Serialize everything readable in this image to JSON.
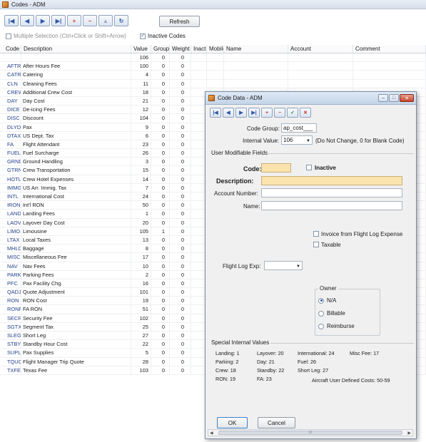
{
  "window": {
    "title": "Codes - ADM"
  },
  "toolbar": {
    "buttons": [
      {
        "icon": "first-record-icon",
        "glyph": "|◀"
      },
      {
        "icon": "previous-record-icon",
        "glyph": "◀"
      },
      {
        "icon": "next-record-icon",
        "glyph": "▶"
      },
      {
        "icon": "last-record-icon",
        "glyph": "▶|"
      },
      {
        "icon": "add-record-icon",
        "glyph": "+"
      },
      {
        "icon": "delete-record-icon",
        "glyph": "−"
      },
      {
        "icon": "up-icon",
        "glyph": "▲"
      },
      {
        "icon": "refresh-icon",
        "glyph": "↻"
      }
    ],
    "refresh_label": "Refresh"
  },
  "options": {
    "multi_select_label": "Multiple Selection (Ctrl+Click or Shift+Arrow)",
    "multi_select_checked": false,
    "inactive_label": "Inactive Codes",
    "inactive_checked": true
  },
  "grid": {
    "headers": [
      "Code",
      "Description",
      "Value",
      "Group",
      "Weight",
      "Inactive",
      "Mobile",
      "Name",
      "Account",
      "Comment"
    ],
    "rows": [
      {
        "code": "",
        "desc": "",
        "value": "106",
        "group": "0",
        "weight": "0"
      },
      {
        "code": "AFTR",
        "desc": "After Hours Fee",
        "value": "100",
        "group": "0",
        "weight": "0"
      },
      {
        "code": "CATR",
        "desc": "Catering",
        "value": "4",
        "group": "0",
        "weight": "0"
      },
      {
        "code": "CLN",
        "desc": "Cleaning Fees",
        "value": "11",
        "group": "0",
        "weight": "0"
      },
      {
        "code": "CREW",
        "desc": "Additional Crew Cost",
        "value": "18",
        "group": "0",
        "weight": "0"
      },
      {
        "code": "DAY",
        "desc": "Day Cost",
        "value": "21",
        "group": "0",
        "weight": "0"
      },
      {
        "code": "DICE",
        "desc": "De-icing Fees",
        "value": "12",
        "group": "0",
        "weight": "0"
      },
      {
        "code": "DISC",
        "desc": "Discount",
        "value": "104",
        "group": "0",
        "weight": "0"
      },
      {
        "code": "DLYD",
        "desc": "Pax",
        "value": "9",
        "group": "0",
        "weight": "0"
      },
      {
        "code": "DTAX",
        "desc": "US Dept. Tax",
        "value": "6",
        "group": "0",
        "weight": "0"
      },
      {
        "code": "FA",
        "desc": "Flight Attendant",
        "value": "23",
        "group": "0",
        "weight": "0"
      },
      {
        "code": "FUEL",
        "desc": "Fuel Surcharge",
        "value": "26",
        "group": "0",
        "weight": "0"
      },
      {
        "code": "GRND",
        "desc": "Ground Handling",
        "value": "3",
        "group": "0",
        "weight": "0"
      },
      {
        "code": "GTRN",
        "desc": "Crew Transportation",
        "value": "15",
        "group": "0",
        "weight": "0"
      },
      {
        "code": "HOTL",
        "desc": "Crew Hotel Expenses",
        "value": "14",
        "group": "0",
        "weight": "0"
      },
      {
        "code": "IMMG",
        "desc": "US Arr. Immig. Tax",
        "value": "7",
        "group": "0",
        "weight": "0"
      },
      {
        "code": "INTL",
        "desc": "International Cost",
        "value": "24",
        "group": "0",
        "weight": "0"
      },
      {
        "code": "IRON",
        "desc": "Int'l RON",
        "value": "50",
        "group": "0",
        "weight": "0"
      },
      {
        "code": "LAND",
        "desc": "Landing Fees",
        "value": "1",
        "group": "0",
        "weight": "0"
      },
      {
        "code": "LAOV",
        "desc": "Layover Day Cost",
        "value": "20",
        "group": "0",
        "weight": "0"
      },
      {
        "code": "LIMO",
        "desc": "Limousine",
        "value": "105",
        "group": "1",
        "weight": "0"
      },
      {
        "code": "LTAX",
        "desc": "Local Taxes",
        "value": "13",
        "group": "0",
        "weight": "0"
      },
      {
        "code": "MHLD",
        "desc": "Baggage",
        "value": "8",
        "group": "0",
        "weight": "0"
      },
      {
        "code": "MISC",
        "desc": "Miscellaneous Fee",
        "value": "17",
        "group": "0",
        "weight": "0"
      },
      {
        "code": "NAV",
        "desc": "Nav Fees",
        "value": "10",
        "group": "0",
        "weight": "0"
      },
      {
        "code": "PARK",
        "desc": "Parking Fees",
        "value": "2",
        "group": "0",
        "weight": "0"
      },
      {
        "code": "PFC",
        "desc": "Pax Facility Chg.",
        "value": "16",
        "group": "0",
        "weight": "0"
      },
      {
        "code": "QADJ",
        "desc": "Quote Adjustment",
        "value": "101",
        "group": "0",
        "weight": "0"
      },
      {
        "code": "RON",
        "desc": "RON Cost",
        "value": "19",
        "group": "0",
        "weight": "0"
      },
      {
        "code": "RONF",
        "desc": "FA RON",
        "value": "51",
        "group": "0",
        "weight": "0"
      },
      {
        "code": "SECR",
        "desc": "Security Fee",
        "value": "102",
        "group": "0",
        "weight": "0"
      },
      {
        "code": "SGTX",
        "desc": "Segment Tax",
        "value": "25",
        "group": "0",
        "weight": "0"
      },
      {
        "code": "SLEG",
        "desc": "Short Leg",
        "value": "27",
        "group": "0",
        "weight": "0"
      },
      {
        "code": "STBY",
        "desc": "Standby Hour Cost",
        "value": "22",
        "group": "0",
        "weight": "0"
      },
      {
        "code": "SUPL",
        "desc": "Pax Supplies",
        "value": "5",
        "group": "0",
        "weight": "0"
      },
      {
        "code": "TQUO",
        "desc": "Flight Manager Trip Quote",
        "value": "28",
        "group": "0",
        "weight": "0"
      },
      {
        "code": "TXFE",
        "desc": "Texas Fee",
        "value": "103",
        "group": "0",
        "weight": "0"
      }
    ]
  },
  "dialog": {
    "title": "Code Data - ADM",
    "code_group_label": "Code Group:",
    "code_group_value": "ap_cost___",
    "internal_value_label": "Internal Value:",
    "internal_value": "106",
    "internal_value_hint": "(Do Not Change, 0 for Blank Code)",
    "user_fields_label": "User Modifiable Fields",
    "code_label": "Code:",
    "code_value": "",
    "inactive_label": "Inactive",
    "description_label": "Description:",
    "description_value": "",
    "account_label": "Account Number:",
    "account_value": "",
    "name_label": "Name:",
    "name_value": "",
    "invoice_label": "Invoice from Flight Log Expense",
    "taxable_label": "Taxable",
    "flight_log_label": "Flight Log Exp:",
    "flight_log_value": "",
    "owner_label": "Owner",
    "owner_options": [
      "N/A",
      "Billable",
      "Reimburse"
    ],
    "owner_selected": "N/A",
    "special_label": "Special Internal Values",
    "special_values": [
      "Landing: 1",
      "Layover: 20",
      "International: 24",
      "Misc Fee: 17",
      "Parking: 2",
      "Day: 21",
      "Fuel: 26",
      "Crew: 18",
      "Standby: 22",
      "Short Leg: 27",
      "RON: 19",
      "FA: 23",
      "Aircraft User Defined Costs: 50-59"
    ],
    "ok_label": "OK",
    "cancel_label": "Cancel",
    "scroll_thumb_label": "III"
  }
}
